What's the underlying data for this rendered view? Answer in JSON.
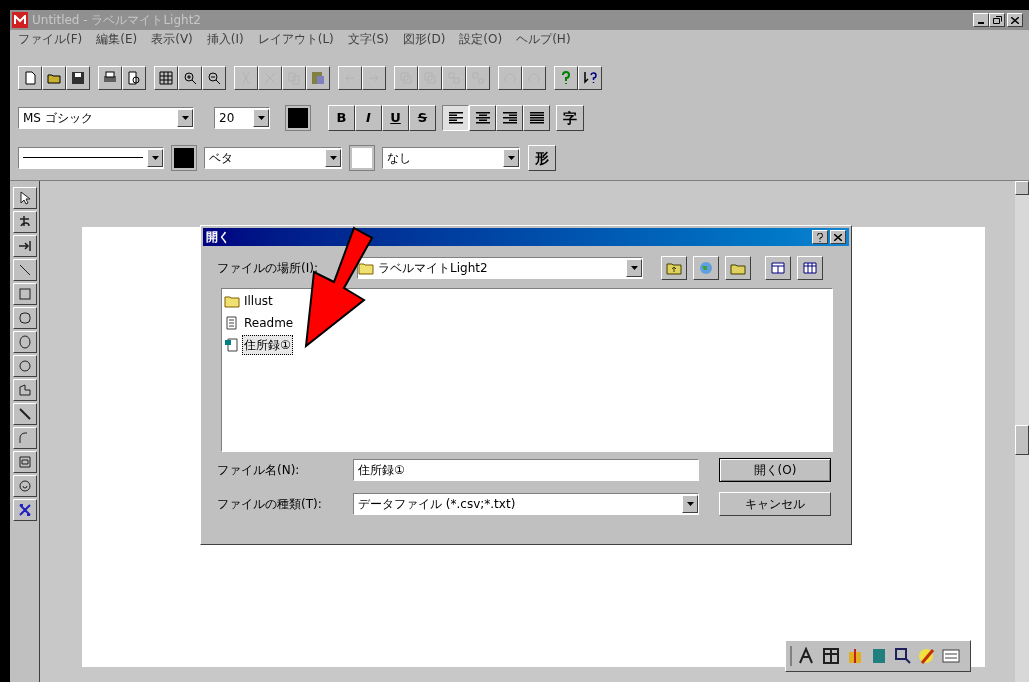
{
  "window": {
    "title": "Untitled - ラベルマイトLight2"
  },
  "menu": [
    "ファイル(F)",
    "編集(E)",
    "表示(V)",
    "挿入(I)",
    "レイアウト(L)",
    "文字(S)",
    "図形(D)",
    "設定(O)",
    "ヘルプ(H)"
  ],
  "toolbar": [
    {
      "kind": "new",
      "disabled": false
    },
    {
      "kind": "open",
      "disabled": false
    },
    {
      "kind": "save",
      "disabled": false
    },
    {
      "kind": "sep"
    },
    {
      "kind": "print",
      "disabled": false
    },
    {
      "kind": "preview",
      "disabled": false
    },
    {
      "kind": "sep"
    },
    {
      "kind": "grid",
      "disabled": false
    },
    {
      "kind": "zoomin",
      "disabled": false
    },
    {
      "kind": "zoomout",
      "disabled": false
    },
    {
      "kind": "sep"
    },
    {
      "kind": "cut",
      "disabled": true
    },
    {
      "kind": "delete",
      "disabled": true
    },
    {
      "kind": "copy",
      "disabled": true
    },
    {
      "kind": "paste",
      "disabled": false
    },
    {
      "kind": "sep"
    },
    {
      "kind": "undo",
      "disabled": true
    },
    {
      "kind": "redo",
      "disabled": true
    },
    {
      "kind": "sep"
    },
    {
      "kind": "front",
      "disabled": true
    },
    {
      "kind": "back",
      "disabled": true
    },
    {
      "kind": "group",
      "disabled": true
    },
    {
      "kind": "ungroup",
      "disabled": true
    },
    {
      "kind": "sep"
    },
    {
      "kind": "rotl",
      "disabled": true
    },
    {
      "kind": "rotr",
      "disabled": true
    },
    {
      "kind": "sep"
    },
    {
      "kind": "help",
      "disabled": false
    },
    {
      "kind": "ctxhelp",
      "disabled": false
    }
  ],
  "format_bar": {
    "font": "MS ゴシック",
    "size": "20",
    "styles": [
      "B",
      "I",
      "U",
      "S"
    ],
    "align": [
      {
        "kind": "left",
        "selected": true
      },
      {
        "kind": "center",
        "selected": false
      },
      {
        "kind": "right",
        "selected": false
      },
      {
        "kind": "justify",
        "selected": false
      }
    ],
    "char_button": "字"
  },
  "line_bar": {
    "fill": "ベタ",
    "pattern": "なし",
    "shape_button": "形"
  },
  "tools": [
    {
      "kind": "select"
    },
    {
      "kind": "text"
    },
    {
      "kind": "insert"
    },
    {
      "kind": "line"
    },
    {
      "kind": "rect"
    },
    {
      "kind": "roundrect"
    },
    {
      "kind": "ellipse"
    },
    {
      "kind": "circle"
    },
    {
      "kind": "polygon"
    },
    {
      "kind": "pen"
    },
    {
      "kind": "arc"
    },
    {
      "kind": "frame"
    },
    {
      "kind": "stamp"
    },
    {
      "kind": "barcode"
    }
  ],
  "dialog": {
    "title": "開く",
    "location_label": "ファイルの場所(I):",
    "location": "ラベルマイトLight2",
    "files": [
      {
        "kind": "folder",
        "name": "Illust",
        "selected": false
      },
      {
        "kind": "text",
        "name": "Readme",
        "selected": false
      },
      {
        "kind": "data",
        "name": "住所録①",
        "selected": true
      }
    ],
    "filename_label": "ファイル名(N):",
    "filename": "住所録①",
    "type_label": "ファイルの種類(T):",
    "type": "データファイル (*.csv;*.txt)",
    "open_button": "開く(O)",
    "cancel_button": "キャンセル"
  }
}
